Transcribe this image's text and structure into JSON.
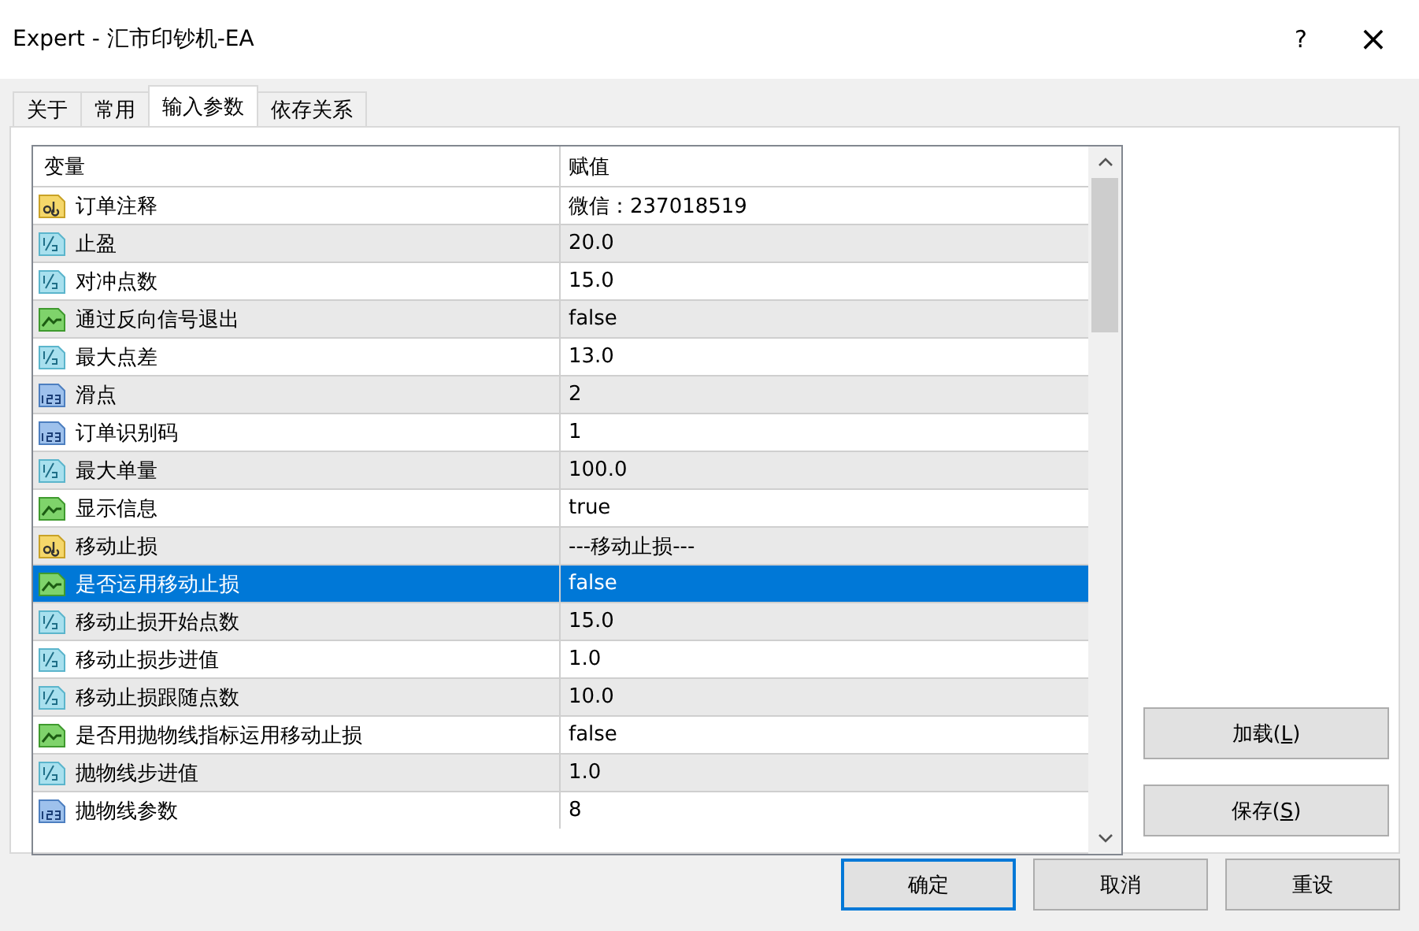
{
  "window": {
    "title": "Expert - 汇市印钞机-EA",
    "help": "?",
    "close": "×"
  },
  "tabs": [
    {
      "label": "关于",
      "selected": false
    },
    {
      "label": "常用",
      "selected": false
    },
    {
      "label": "输入参数",
      "selected": true
    },
    {
      "label": "依存关系",
      "selected": false
    }
  ],
  "table": {
    "columns": [
      "变量",
      "赋值"
    ],
    "rows": [
      {
        "kind": "string",
        "name": "订单注释",
        "value": "微信：237018519",
        "selected": false
      },
      {
        "kind": "double",
        "name": "止盈",
        "value": "20.0",
        "selected": false
      },
      {
        "kind": "double",
        "name": "对冲点数",
        "value": "15.0",
        "selected": false
      },
      {
        "kind": "bool",
        "name": "通过反向信号退出",
        "value": "false",
        "selected": false
      },
      {
        "kind": "double",
        "name": "最大点差",
        "value": "13.0",
        "selected": false
      },
      {
        "kind": "int",
        "name": "滑点",
        "value": "2",
        "selected": false
      },
      {
        "kind": "int",
        "name": "订单识别码",
        "value": "1",
        "selected": false
      },
      {
        "kind": "double",
        "name": "最大单量",
        "value": "100.0",
        "selected": false
      },
      {
        "kind": "bool",
        "name": "显示信息",
        "value": "true",
        "selected": false
      },
      {
        "kind": "string",
        "name": "移动止损",
        "value": "---移动止损---",
        "selected": false
      },
      {
        "kind": "bool",
        "name": "是否运用移动止损",
        "value": "false",
        "selected": true
      },
      {
        "kind": "double",
        "name": "移动止损开始点数",
        "value": "15.0",
        "selected": false
      },
      {
        "kind": "double",
        "name": "移动止损步进值",
        "value": "1.0",
        "selected": false
      },
      {
        "kind": "double",
        "name": "移动止损跟随点数",
        "value": "10.0",
        "selected": false
      },
      {
        "kind": "bool",
        "name": "是否用抛物线指标运用移动止损",
        "value": "false",
        "selected": false
      },
      {
        "kind": "double",
        "name": "抛物线步进值",
        "value": "1.0",
        "selected": false
      },
      {
        "kind": "int",
        "name": "抛物线参数",
        "value": "8",
        "selected": false
      }
    ]
  },
  "side_buttons": [
    {
      "label": "加载(",
      "key": "L",
      "after": ")"
    },
    {
      "label": "保存(",
      "key": "S",
      "after": ")"
    }
  ],
  "buttons": [
    {
      "label": "确定",
      "default": true
    },
    {
      "label": "取消",
      "default": false
    },
    {
      "label": "重设",
      "default": false
    }
  ]
}
